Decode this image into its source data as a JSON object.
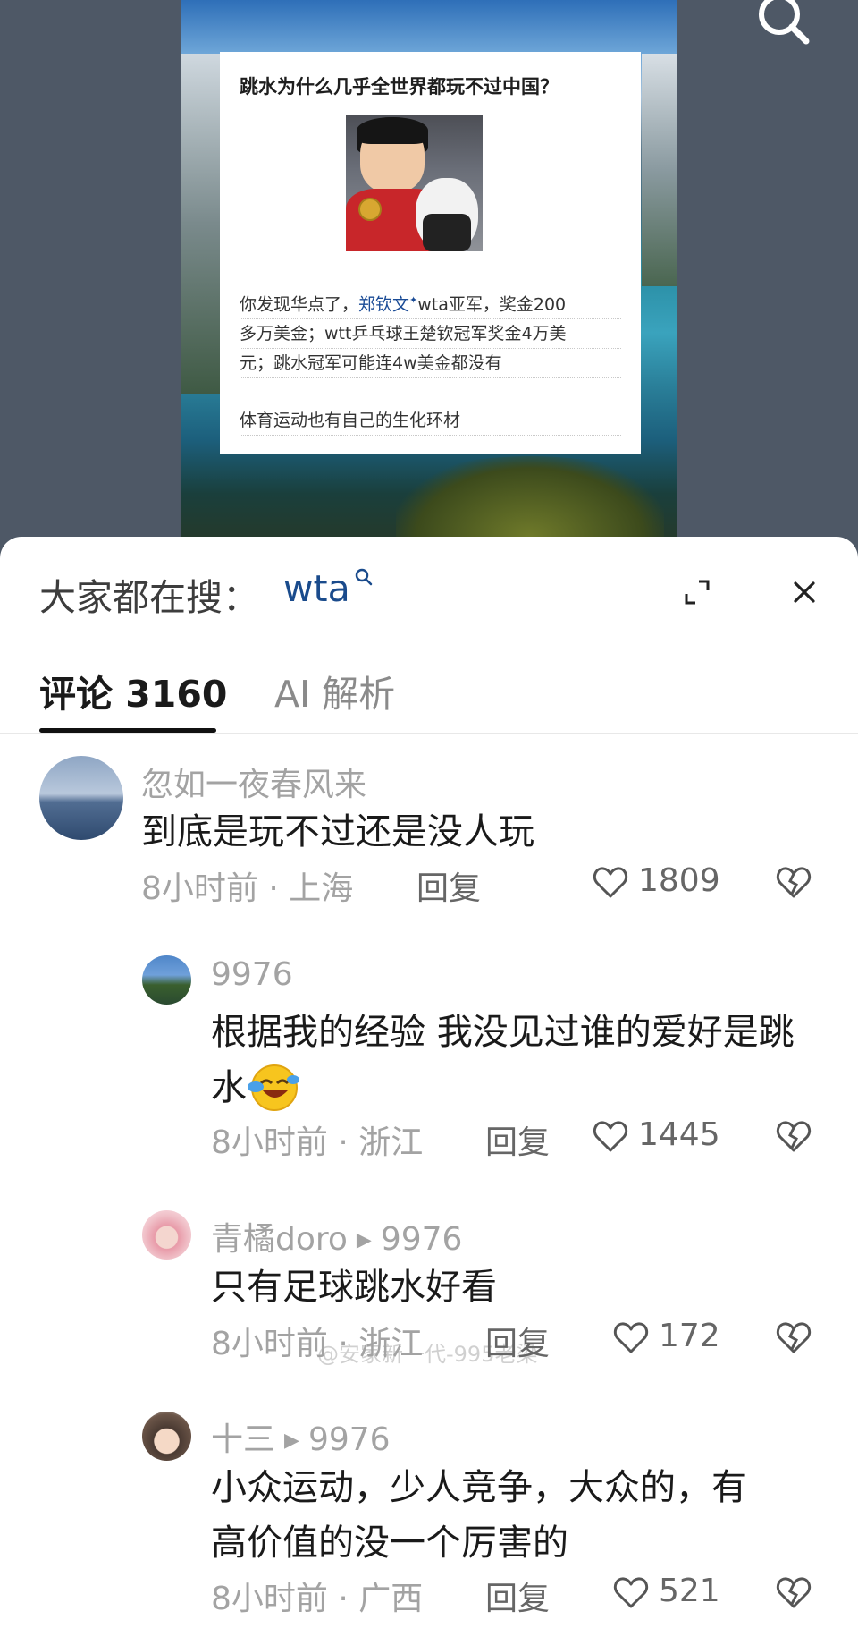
{
  "video": {
    "card": {
      "title": "跳水为什么几乎全世界都玩不过中国？",
      "body_line1_pre": "你发现华点了，",
      "body_name": "郑钦文",
      "body_sup": "✦",
      "body_line1_post": "wta亚军，奖金200",
      "body_line2": "多万美金；wtt乒乓球王楚钦冠军奖金4万美",
      "body_line3": "元；跳水冠军可能连4w美金都没有",
      "note": "体育运动也有自己的生化环材"
    }
  },
  "search": {
    "label": "大家都在搜：",
    "term": "wta"
  },
  "tabs": {
    "comments": "评论 3160",
    "ai": "AI 解析"
  },
  "watermark": "@安家新一代-995老梁",
  "comments": [
    {
      "name": "忽如一夜春风来",
      "text": "到底是玩不过还是没人玩",
      "time": "8小时前",
      "location": "上海",
      "reply": "回复",
      "likes": "1809"
    },
    {
      "name": "9976",
      "text": "根据我的经验 我没见过谁的爱好是跳水",
      "time": "8小时前",
      "location": "浙江",
      "reply": "回复",
      "likes": "1445"
    },
    {
      "name": "青橘doro",
      "reply_to": "9976",
      "text": "只有足球跳水好看",
      "time": "8小时前",
      "location": "浙江",
      "reply": "回复",
      "likes": "172"
    },
    {
      "name": "十三",
      "reply_to": "9976",
      "text_line1": "小众运动，少人竞争，大众的，有",
      "text_line2": "高价值的没一个厉害的",
      "time": "8小时前",
      "location": "广西",
      "reply": "回复",
      "likes": "521"
    }
  ],
  "meta_separator": "·",
  "icons": [
    "search-icon",
    "expand-icon",
    "close-icon",
    "heart-icon",
    "broken-heart-icon",
    "reply-arrow-icon"
  ],
  "colors": {
    "accent_blue": "#1a4b8c",
    "muted_text": "#a3a3a3",
    "tab_active": "#111111"
  }
}
